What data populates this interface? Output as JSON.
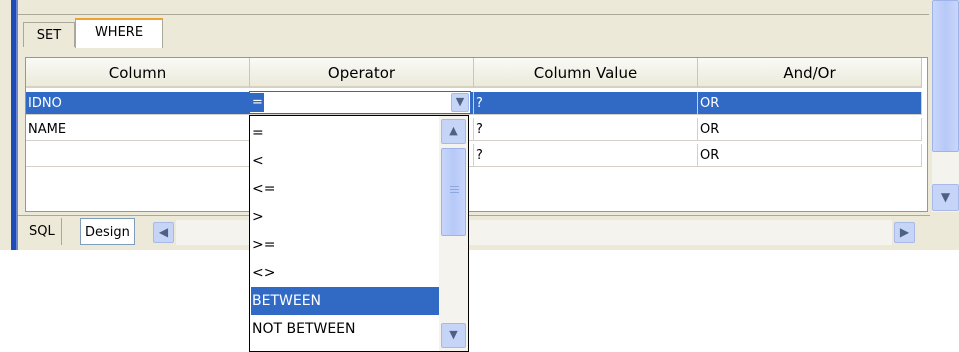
{
  "tabs": {
    "set": "SET",
    "where": "WHERE"
  },
  "grid": {
    "headers": [
      "Column",
      "Operator",
      "Column Value",
      "And/Or"
    ],
    "rows": [
      {
        "column": "IDNO",
        "operator": "=",
        "value": "?",
        "andor": "OR"
      },
      {
        "column": "NAME",
        "operator": "",
        "value": "?",
        "andor": "OR"
      },
      {
        "column": "",
        "operator": "",
        "value": "?",
        "andor": "OR"
      }
    ]
  },
  "bottom_tabs": {
    "sql": "SQL",
    "design": "Design"
  },
  "combo": {
    "value": "="
  },
  "operator_options": [
    "=",
    "<",
    "<=",
    ">",
    ">=",
    "<>",
    "BETWEEN",
    "NOT BETWEEN"
  ],
  "selected_option": "BETWEEN",
  "icons": {
    "down": "chevron-down-icon",
    "up": "chevron-up-icon",
    "left": "chevron-left-icon",
    "right": "chevron-right-icon"
  },
  "colors": {
    "selection": "#316ac5",
    "tab_accent": "#f0a030",
    "scroll": "#c6d4f7"
  }
}
